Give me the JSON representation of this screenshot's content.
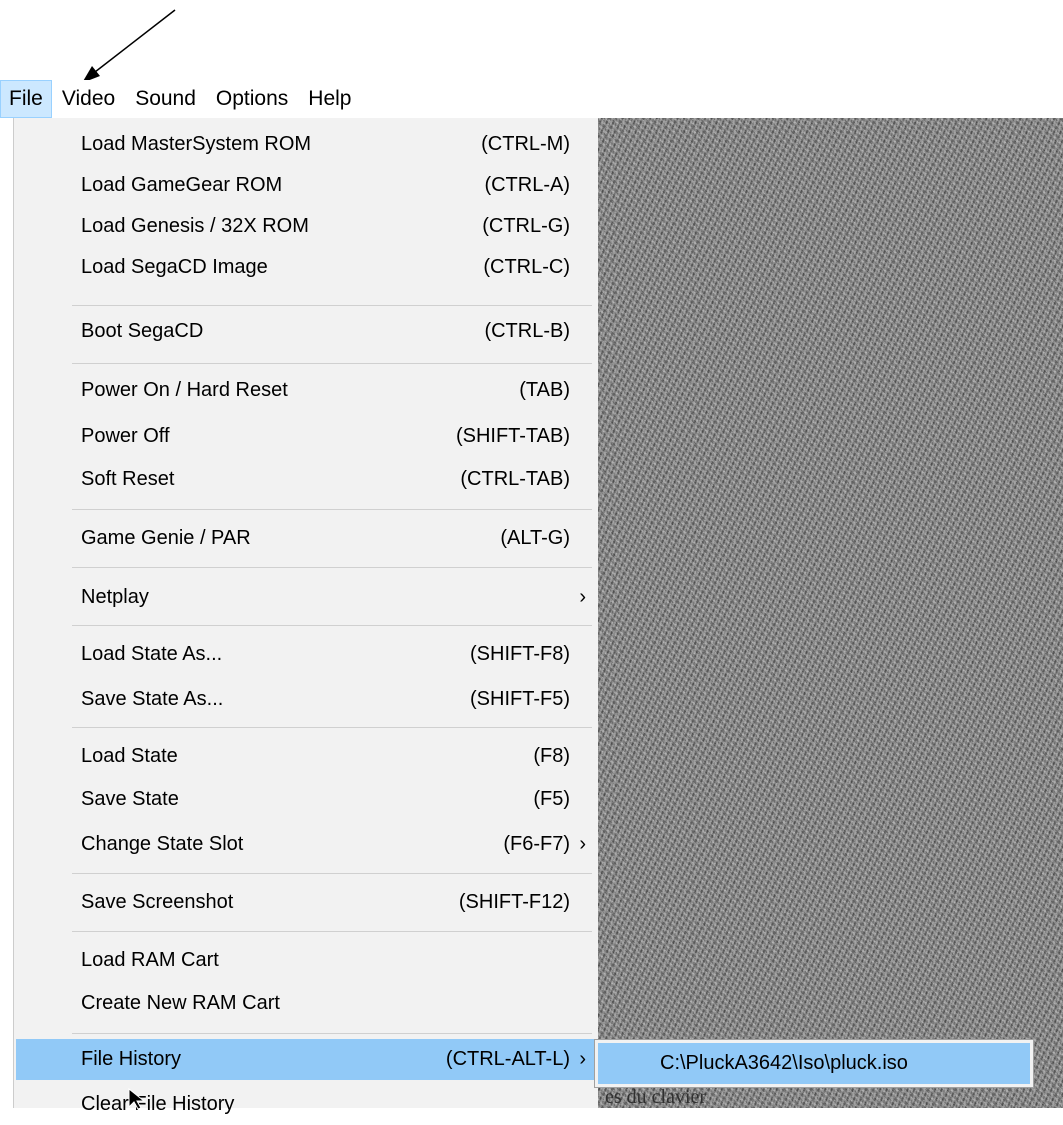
{
  "menubar": {
    "items": [
      {
        "label": "File"
      },
      {
        "label": "Video"
      },
      {
        "label": "Sound"
      },
      {
        "label": "Options"
      },
      {
        "label": "Help"
      }
    ]
  },
  "file_menu": {
    "items": [
      {
        "label": "Load MasterSystem ROM",
        "shortcut": "(CTRL-M)"
      },
      {
        "label": "Load GameGear ROM",
        "shortcut": "(CTRL-A)"
      },
      {
        "label": "Load Genesis / 32X ROM",
        "shortcut": "(CTRL-G)"
      },
      {
        "label": "Load SegaCD Image",
        "shortcut": "(CTRL-C)"
      },
      {
        "label": "Boot SegaCD",
        "shortcut": "(CTRL-B)"
      },
      {
        "label": "Power On / Hard Reset",
        "shortcut": "(TAB)"
      },
      {
        "label": "Power Off",
        "shortcut": "(SHIFT-TAB)"
      },
      {
        "label": "Soft Reset",
        "shortcut": "(CTRL-TAB)"
      },
      {
        "label": "Game Genie / PAR",
        "shortcut": "(ALT-G)"
      },
      {
        "label": "Netplay",
        "shortcut": ""
      },
      {
        "label": "Load State As...",
        "shortcut": "(SHIFT-F8)"
      },
      {
        "label": "Save State As...",
        "shortcut": "(SHIFT-F5)"
      },
      {
        "label": "Load State",
        "shortcut": "(F8)"
      },
      {
        "label": "Save State",
        "shortcut": "(F5)"
      },
      {
        "label": "Change State Slot",
        "shortcut": "(F6-F7)"
      },
      {
        "label": "Save Screenshot",
        "shortcut": "(SHIFT-F12)"
      },
      {
        "label": "Load RAM Cart",
        "shortcut": ""
      },
      {
        "label": "Create New RAM Cart",
        "shortcut": ""
      },
      {
        "label": "File History",
        "shortcut": "(CTRL-ALT-L)"
      },
      {
        "label": "Clear File History",
        "shortcut": ""
      }
    ],
    "submenu_arrow": "›"
  },
  "file_history_submenu": {
    "items": [
      {
        "label": "C:\\PluckA3642\\Iso\\pluck.iso"
      }
    ]
  },
  "background_text": "es du clavier",
  "colors": {
    "highlight": "#91c9f7",
    "menubar_active": "#cce8ff",
    "menu_bg": "#f2f2f2"
  }
}
